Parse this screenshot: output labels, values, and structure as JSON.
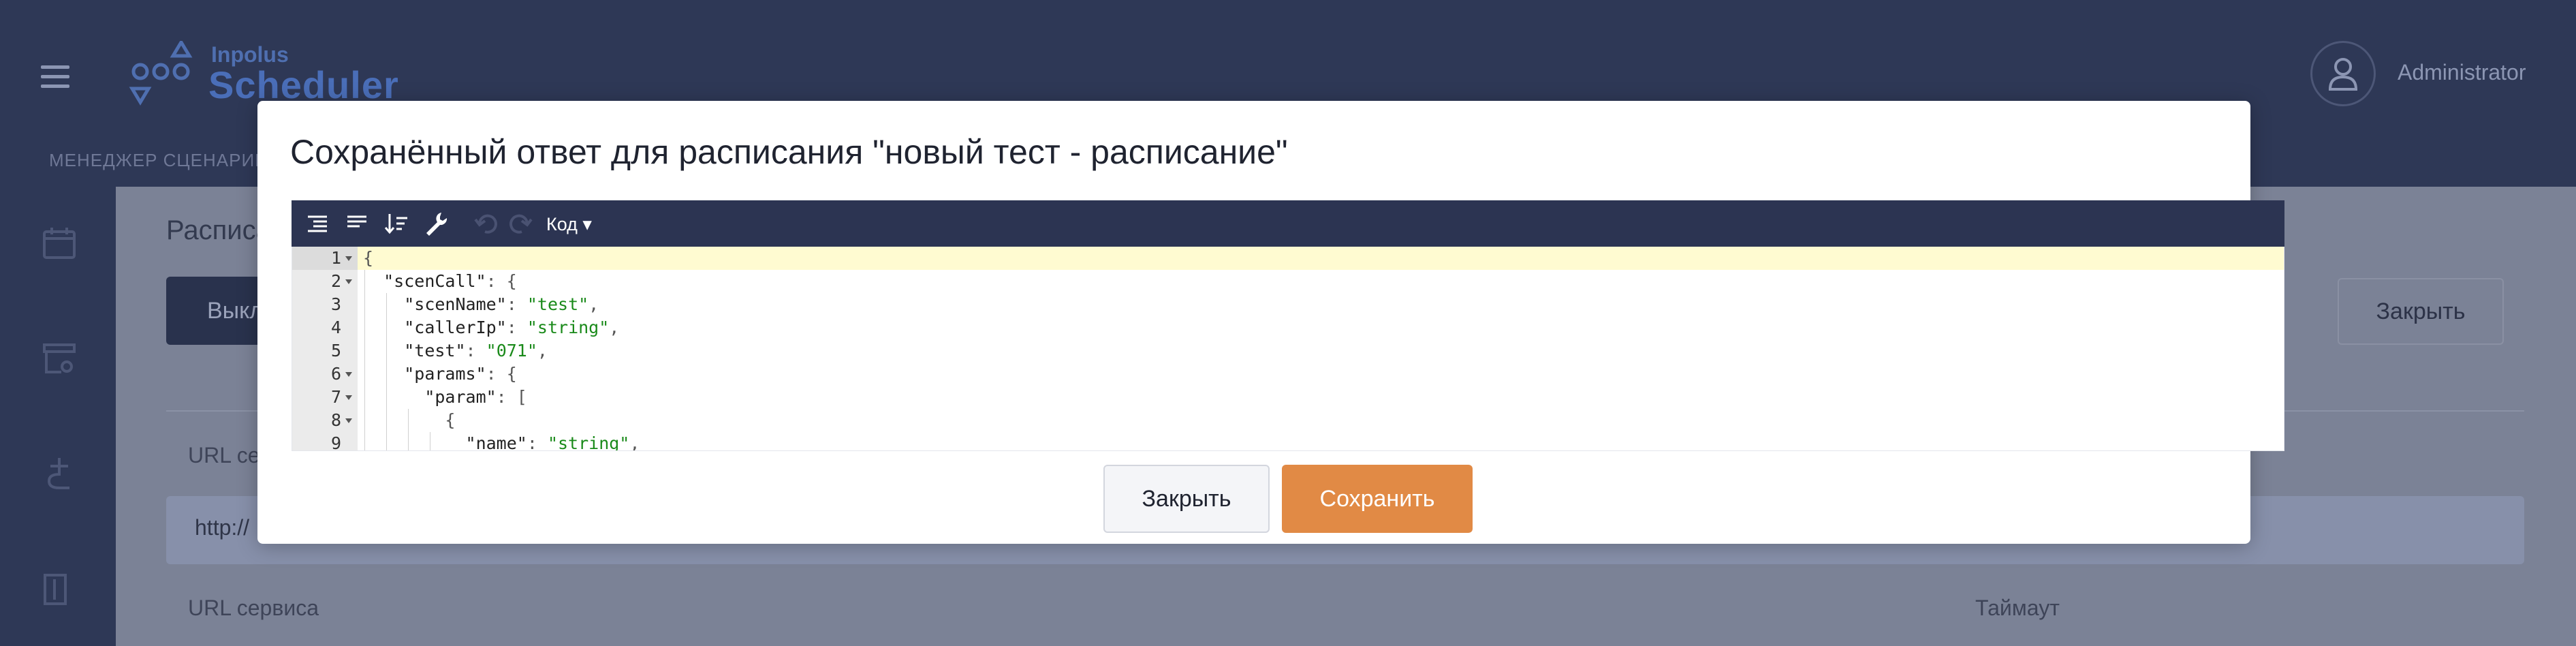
{
  "app": {
    "logo_small": "Inpolus",
    "logo_big": "Scheduler",
    "user_name": "Administrator",
    "top_nav": "МЕНЕДЖЕР СЦЕНАРИЕ"
  },
  "background": {
    "page_title": "Расписа",
    "btn_dark": "Выкл",
    "btn_close": "Закрыть",
    "label_url_1": "URL се",
    "input_url": "http://",
    "label_url_2": "URL сервиса",
    "label_timeout": "Таймаут"
  },
  "modal": {
    "title": "Сохранённый ответ для расписания \"новый тест - расписание\"",
    "mode_label": "Код ▾",
    "toolbar_icons": [
      "format-icon",
      "compact-icon",
      "sort-icon",
      "repair-icon",
      "undo-icon",
      "redo-icon"
    ],
    "close_label": "Закрыть",
    "save_label": "Сохранить",
    "save_color": "#e18a45"
  },
  "code_lines": [
    {
      "n": "1",
      "text": "{"
    },
    {
      "n": "2",
      "text": "  \"scenCall\": {"
    },
    {
      "n": "3",
      "text": "    \"scenName\": \"test\","
    },
    {
      "n": "4",
      "text": "    \"callerIp\": \"string\","
    },
    {
      "n": "5",
      "text": "    \"test\": \"071\","
    },
    {
      "n": "6",
      "text": "    \"params\": {"
    },
    {
      "n": "7",
      "text": "      \"param\": ["
    },
    {
      "n": "8",
      "text": "        {"
    },
    {
      "n": "9",
      "text": "          \"name\": \"string\","
    }
  ]
}
